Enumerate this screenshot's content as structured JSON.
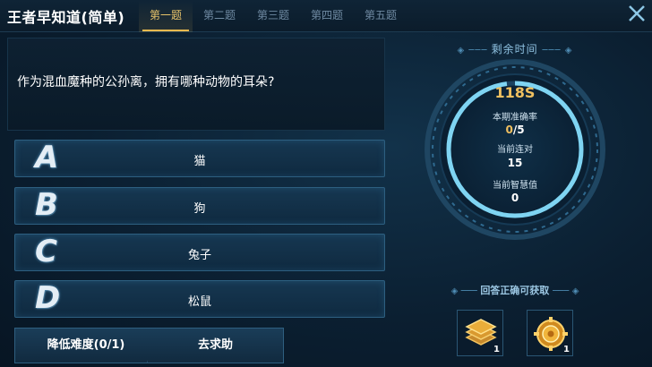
{
  "header": {
    "title": "王者早知道(简单)",
    "tabs": [
      {
        "label": "第一题",
        "active": true
      },
      {
        "label": "第二题",
        "active": false
      },
      {
        "label": "第三题",
        "active": false
      },
      {
        "label": "第四题",
        "active": false
      },
      {
        "label": "第五题",
        "active": false
      }
    ],
    "close_icon": "close-icon"
  },
  "question": {
    "text": "作为混血魔种的公孙离，拥有哪种动物的耳朵?"
  },
  "options": [
    {
      "letter": "A",
      "text": "猫"
    },
    {
      "letter": "B",
      "text": "狗"
    },
    {
      "letter": "C",
      "text": "兔子"
    },
    {
      "letter": "D",
      "text": "松鼠"
    }
  ],
  "buttons": {
    "lower_difficulty": "降低难度(0/1)",
    "ask_help": "去求助"
  },
  "timer": {
    "label": "剩余时间",
    "remaining": "118S",
    "remaining_fraction": 0.98
  },
  "stats": {
    "accuracy_label": "本期准确率",
    "accuracy_correct": "0",
    "accuracy_total": "/5",
    "streak_label": "当前连对",
    "streak_value": "15",
    "wisdom_label": "当前智慧值",
    "wisdom_value": "0"
  },
  "rewards": {
    "label": "回答正确可获取",
    "items": [
      {
        "icon": "stack-icon",
        "count": "1"
      },
      {
        "icon": "coin-icon",
        "count": "1"
      }
    ]
  },
  "colors": {
    "accent_gold": "#f0c060",
    "tab_active": "#e9b94f",
    "ring_cyan": "#7fd4f2"
  }
}
